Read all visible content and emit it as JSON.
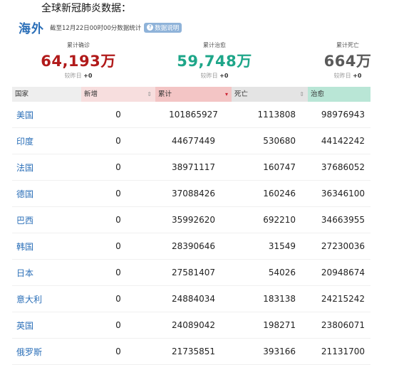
{
  "page_heading": "全球新冠肺炎数据：",
  "section": {
    "title": "海外",
    "note": "截至12月22日00时00分数据统计",
    "explain_label": "数据说明"
  },
  "stats": [
    {
      "label": "累计确诊",
      "value": "64,193万",
      "delta_label": "较昨日",
      "delta": "+0",
      "color": "#b11a1a"
    },
    {
      "label": "累计治愈",
      "value": "59,748万",
      "delta_label": "较昨日",
      "delta": "+0",
      "color": "#1ea689"
    },
    {
      "label": "累计死亡",
      "value": "664万",
      "delta_label": "较昨日",
      "delta": "+0",
      "color": "#5a5a5a"
    }
  ],
  "table": {
    "headers": [
      "国家",
      "新增",
      "累计",
      "死亡",
      "治愈"
    ],
    "rows": [
      {
        "country": "美国",
        "new": "0",
        "total": "101865927",
        "dead": "1113808",
        "cured": "98976943"
      },
      {
        "country": "印度",
        "new": "0",
        "total": "44677449",
        "dead": "530680",
        "cured": "44142242"
      },
      {
        "country": "法国",
        "new": "0",
        "total": "38971117",
        "dead": "160747",
        "cured": "37686052"
      },
      {
        "country": "德国",
        "new": "0",
        "total": "37088426",
        "dead": "160246",
        "cured": "36346100"
      },
      {
        "country": "巴西",
        "new": "0",
        "total": "35992620",
        "dead": "692210",
        "cured": "34663955"
      },
      {
        "country": "韩国",
        "new": "0",
        "total": "28390646",
        "dead": "31549",
        "cured": "27230036"
      },
      {
        "country": "日本",
        "new": "0",
        "total": "27581407",
        "dead": "54026",
        "cured": "20948674"
      },
      {
        "country": "意大利",
        "new": "0",
        "total": "24884034",
        "dead": "183138",
        "cured": "24215242"
      },
      {
        "country": "英国",
        "new": "0",
        "total": "24089042",
        "dead": "198271",
        "cured": "23806071"
      },
      {
        "country": "俄罗斯",
        "new": "0",
        "total": "21735851",
        "dead": "393166",
        "cured": "21131700"
      }
    ]
  }
}
